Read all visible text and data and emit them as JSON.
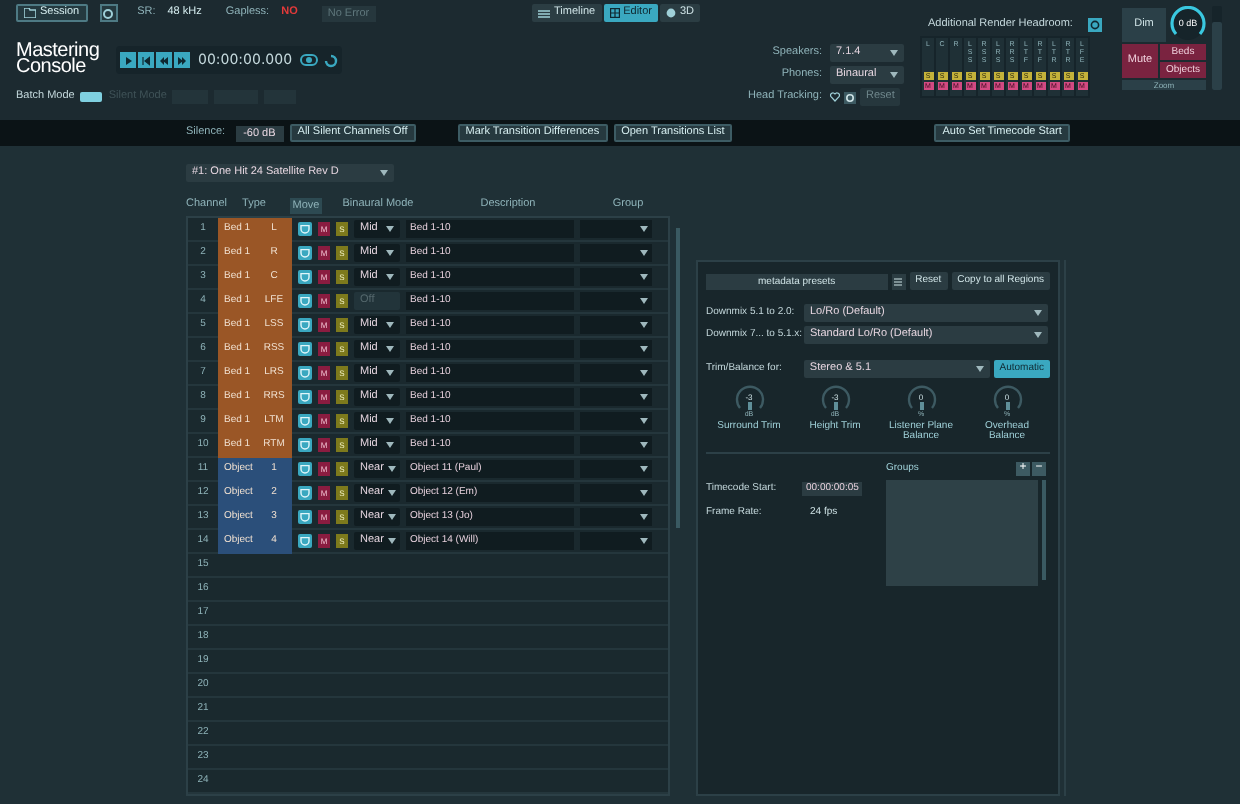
{
  "header": {
    "session": "Session",
    "sr_label": "SR:",
    "sr_value": "48 kHz",
    "gapless_label": "Gapless:",
    "gapless_value": "NO",
    "status": "No Error",
    "logo": [
      "Mastering",
      "Console"
    ],
    "timecode": "00:00:00.000",
    "view_tabs": [
      {
        "label": "Timeline",
        "selected": false
      },
      {
        "label": "Editor",
        "selected": true
      },
      {
        "label": "3D",
        "selected": false
      }
    ],
    "batch_mode": {
      "label": "Batch Mode",
      "on": true
    },
    "silent_mode": "Silent Mode",
    "speakers": {
      "label": "Speakers:",
      "value": "7.1.4"
    },
    "phones": {
      "label": "Phones:",
      "value": "Binaural"
    },
    "head_tracking": {
      "label": "Head Tracking:",
      "reset": "Reset"
    },
    "headroom_label": "Additional Render Headroom:",
    "meters": [
      {
        "label": "L",
        "solo": "S",
        "mute": "M"
      },
      {
        "label": "C",
        "solo": "S",
        "mute": "M"
      },
      {
        "label": "R",
        "solo": "S",
        "mute": "M"
      },
      {
        "label": "LSS",
        "solo": "S",
        "mute": "M"
      },
      {
        "label": "RSS",
        "solo": "S",
        "mute": "M"
      },
      {
        "label": "LRS",
        "solo": "S",
        "mute": "M"
      },
      {
        "label": "RRS",
        "solo": "S",
        "mute": "M"
      },
      {
        "label": "LTF",
        "solo": "S",
        "mute": "M"
      },
      {
        "label": "RTF",
        "solo": "S",
        "mute": "M"
      },
      {
        "label": "LTR",
        "solo": "S",
        "mute": "M"
      },
      {
        "label": "RTR",
        "solo": "S",
        "mute": "M"
      },
      {
        "label": "LFE",
        "solo": "S",
        "mute": "M"
      }
    ],
    "monitor": {
      "dim": "Dim",
      "mute": "Mute",
      "beds": "Beds",
      "objects": "Objects",
      "gain": "0 dB",
      "zoom": {
        "label": "Zoom",
        "level": 1
      },
      "volume": {
        "level": 0.8
      }
    }
  },
  "toolbar": {
    "silence_label": "Silence:",
    "silence_value": "-60 dB",
    "buttons": [
      "All Silent Channels Off",
      "Mark Transition Differences",
      "Open Transitions List"
    ],
    "auto_timecode": "Auto Set Timecode Start"
  },
  "table": {
    "region": "#1: One Hit 24 Satellite Rev D",
    "columns": [
      "Channel",
      "Type",
      "Move",
      "Binaural Mode",
      "Description",
      "Group"
    ],
    "rows": [
      {
        "number": "1",
        "kind": "bed",
        "type": "Bed 1",
        "channel": "L",
        "binaural": "Mid",
        "binaural_disabled": false,
        "description": "Bed 1-10",
        "mute": "M",
        "solo": "S"
      },
      {
        "number": "2",
        "kind": "bed",
        "type": "Bed 1",
        "channel": "R",
        "binaural": "Mid",
        "binaural_disabled": false,
        "description": "Bed 1-10",
        "mute": "M",
        "solo": "S"
      },
      {
        "number": "3",
        "kind": "bed",
        "type": "Bed 1",
        "channel": "C",
        "binaural": "Mid",
        "binaural_disabled": false,
        "description": "Bed 1-10",
        "mute": "M",
        "solo": "S"
      },
      {
        "number": "4",
        "kind": "bed",
        "type": "Bed 1",
        "channel": "LFE",
        "binaural": "Off",
        "binaural_disabled": true,
        "description": "Bed 1-10",
        "mute": "M",
        "solo": "S"
      },
      {
        "number": "5",
        "kind": "bed",
        "type": "Bed 1",
        "channel": "LSS",
        "binaural": "Mid",
        "binaural_disabled": false,
        "description": "Bed 1-10",
        "mute": "M",
        "solo": "S"
      },
      {
        "number": "6",
        "kind": "bed",
        "type": "Bed 1",
        "channel": "RSS",
        "binaural": "Mid",
        "binaural_disabled": false,
        "description": "Bed 1-10",
        "mute": "M",
        "solo": "S"
      },
      {
        "number": "7",
        "kind": "bed",
        "type": "Bed 1",
        "channel": "LRS",
        "binaural": "Mid",
        "binaural_disabled": false,
        "description": "Bed 1-10",
        "mute": "M",
        "solo": "S"
      },
      {
        "number": "8",
        "kind": "bed",
        "type": "Bed 1",
        "channel": "RRS",
        "binaural": "Mid",
        "binaural_disabled": false,
        "description": "Bed 1-10",
        "mute": "M",
        "solo": "S"
      },
      {
        "number": "9",
        "kind": "bed",
        "type": "Bed 1",
        "channel": "LTM",
        "binaural": "Mid",
        "binaural_disabled": false,
        "description": "Bed 1-10",
        "mute": "M",
        "solo": "S"
      },
      {
        "number": "10",
        "kind": "bed",
        "type": "Bed 1",
        "channel": "RTM",
        "binaural": "Mid",
        "binaural_disabled": false,
        "description": "Bed 1-10",
        "mute": "M",
        "solo": "S"
      },
      {
        "number": "11",
        "kind": "object",
        "type": "Object",
        "channel": "1",
        "binaural": "Near",
        "binaural_disabled": false,
        "description": "Object 11 (Paul)",
        "mute": "M",
        "solo": "S"
      },
      {
        "number": "12",
        "kind": "object",
        "type": "Object",
        "channel": "2",
        "binaural": "Near",
        "binaural_disabled": false,
        "description": "Object 12 (Em)",
        "mute": "M",
        "solo": "S"
      },
      {
        "number": "13",
        "kind": "object",
        "type": "Object",
        "channel": "3",
        "binaural": "Near",
        "binaural_disabled": false,
        "description": "Object 13 (Jo)",
        "mute": "M",
        "solo": "S"
      },
      {
        "number": "14",
        "kind": "object",
        "type": "Object",
        "channel": "4",
        "binaural": "Near",
        "binaural_disabled": false,
        "description": "Object 14 (Will)",
        "mute": "M",
        "solo": "S"
      },
      {
        "number": "15",
        "kind": "empty"
      },
      {
        "number": "16",
        "kind": "empty"
      },
      {
        "number": "17",
        "kind": "empty"
      },
      {
        "number": "18",
        "kind": "empty"
      },
      {
        "number": "19",
        "kind": "empty"
      },
      {
        "number": "20",
        "kind": "empty"
      },
      {
        "number": "21",
        "kind": "empty"
      },
      {
        "number": "22",
        "kind": "empty"
      },
      {
        "number": "23",
        "kind": "empty"
      },
      {
        "number": "24",
        "kind": "empty"
      }
    ]
  },
  "panel": {
    "presets": "metadata presets",
    "reset": "Reset",
    "copy": "Copy to all Regions",
    "downmixes": [
      {
        "label": "Downmix 5.1 to 2.0:",
        "value": "Lo/Ro (Default)"
      },
      {
        "label": "Downmix 7... to 5.1.x:",
        "value": "Standard Lo/Ro (Default)"
      }
    ],
    "trim_label": "Trim/Balance for:",
    "trim_value": "Stereo & 5.1",
    "automatic": "Automatic",
    "knobs": [
      {
        "value": "-3",
        "unit": "dB",
        "label": "Surround Trim"
      },
      {
        "value": "-3",
        "unit": "dB",
        "label": "Height Trim"
      },
      {
        "value": "0",
        "unit": "%",
        "label": "Listener Plane Balance"
      },
      {
        "value": "0",
        "unit": "%",
        "label": "Overhead Balance"
      }
    ],
    "timecode_label": "Timecode Start:",
    "timecode_value": "00:00:00:05",
    "frame_rate_label": "Frame Rate:",
    "frame_rate_value": "24 fps",
    "groups_label": "Groups",
    "add": "+",
    "remove": "−"
  }
}
